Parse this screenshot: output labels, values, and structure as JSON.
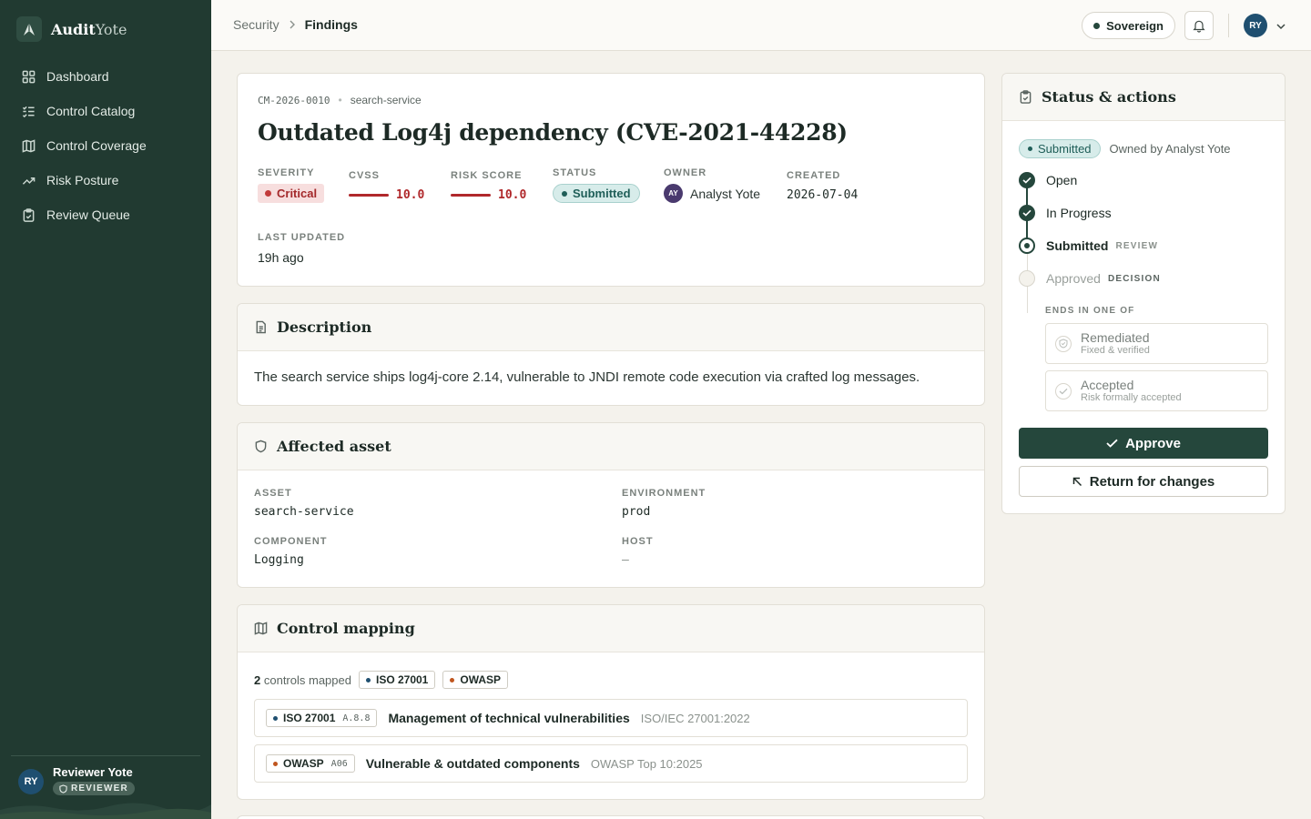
{
  "brand": {
    "name_bold": "Audit",
    "name_light": "Yote"
  },
  "nav": [
    {
      "label": "Dashboard",
      "icon": "dashboard-icon"
    },
    {
      "label": "Control Catalog",
      "icon": "list-check-icon"
    },
    {
      "label": "Control Coverage",
      "icon": "map-icon"
    },
    {
      "label": "Risk Posture",
      "icon": "trend-icon"
    },
    {
      "label": "Review Queue",
      "icon": "clipboard-check-icon"
    }
  ],
  "user": {
    "initials": "RY",
    "name": "Reviewer Yote",
    "role": "REVIEWER"
  },
  "breadcrumb": {
    "parent": "Security",
    "current": "Findings"
  },
  "topbar": {
    "tenant": "Sovereign",
    "avatar": "RY"
  },
  "finding": {
    "id": "CM-2026-0010",
    "service": "search-service",
    "title": "Outdated Log4j dependency (CVE-2021-44228)",
    "labels": {
      "severity": "SEVERITY",
      "cvss": "CVSS",
      "risk": "RISK SCORE",
      "status": "STATUS",
      "owner": "OWNER",
      "created": "CREATED",
      "updated": "LAST UPDATED"
    },
    "severity": "Critical",
    "cvss": "10.0",
    "risk_score": "10.0",
    "status": "Submitted",
    "owner_initials": "AY",
    "owner": "Analyst Yote",
    "created": "2026-07-04",
    "updated": "19h ago"
  },
  "description": {
    "heading": "Description",
    "text": "The search service ships log4j-core 2.14, vulnerable to JNDI remote code execution via crafted log messages."
  },
  "asset": {
    "heading": "Affected asset",
    "labels": {
      "asset": "ASSET",
      "environment": "ENVIRONMENT",
      "component": "COMPONENT",
      "host": "HOST"
    },
    "asset": "search-service",
    "environment": "prod",
    "component": "Logging",
    "host": "—"
  },
  "mapping": {
    "heading": "Control mapping",
    "count": "2",
    "count_label": "controls mapped",
    "frameworks": [
      "ISO 27001",
      "OWASP"
    ],
    "rows": [
      {
        "framework": "ISO 27001",
        "code": "A.8.8",
        "title": "Management of technical vulnerabilities",
        "standard": "ISO/IEC 27001:2022"
      },
      {
        "framework": "OWASP",
        "code": "A06",
        "title": "Vulnerable & outdated components",
        "standard": "OWASP Top 10:2025"
      }
    ]
  },
  "status_panel": {
    "heading": "Status & actions",
    "badge": "Submitted",
    "owned_by": "Owned by Analyst Yote",
    "steps": [
      {
        "label": "Open",
        "tag": ""
      },
      {
        "label": "In Progress",
        "tag": ""
      },
      {
        "label": "Submitted",
        "tag": "REVIEW"
      },
      {
        "label": "Approved",
        "tag": "DECISION"
      }
    ],
    "ends_label": "ENDS IN ONE OF",
    "ends": [
      {
        "name": "Remediated",
        "sub": "Fixed & verified"
      },
      {
        "name": "Accepted",
        "sub": "Risk formally accepted"
      }
    ],
    "approve": "Approve",
    "return": "Return for changes"
  },
  "colors": {
    "sidebar": "#213a31",
    "accent": "#25473c",
    "critical": "#b0282b",
    "submitted": "#1f5e58",
    "iso": "#1f4f70",
    "owasp": "#c0561f"
  }
}
